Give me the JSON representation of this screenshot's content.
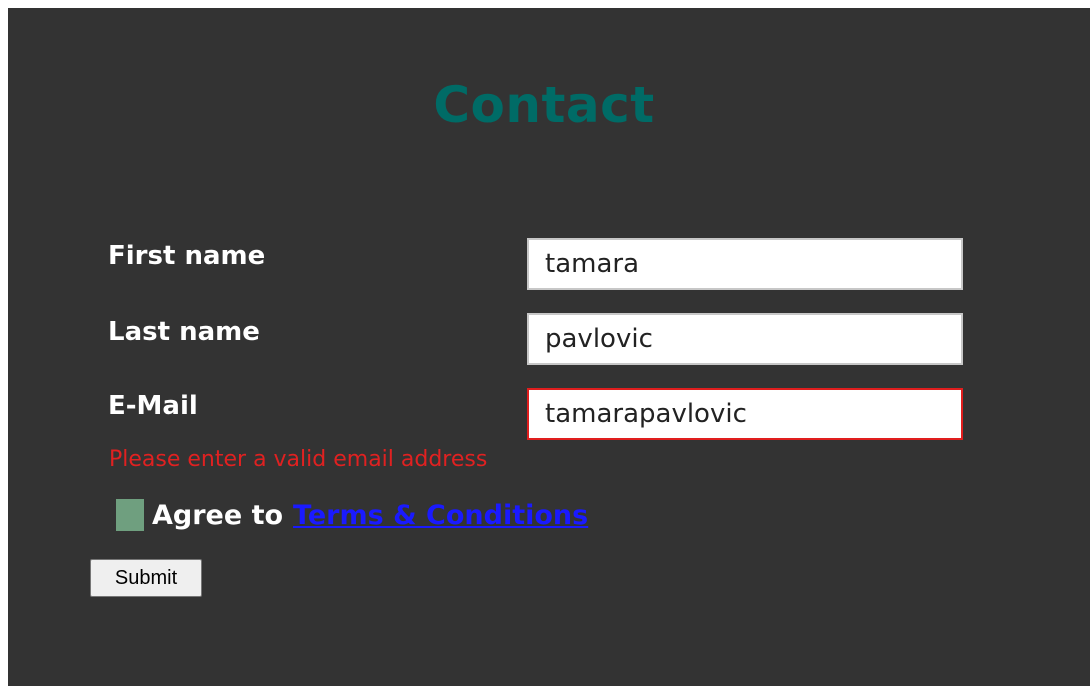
{
  "page": {
    "title": "Contact"
  },
  "form": {
    "first_name": {
      "label": "First name",
      "value": "tamara"
    },
    "last_name": {
      "label": "Last name",
      "value": "pavlovic"
    },
    "email": {
      "label": "E-Mail",
      "value": "tamarapavlovic",
      "error": "Please enter a valid email address"
    },
    "agree": {
      "text": "Agree to",
      "link_text": "Terms & Conditions"
    },
    "submit_label": "Submit"
  },
  "colors": {
    "background": "#333333",
    "title": "#006b66",
    "error": "#e02121",
    "link": "#1a1aff",
    "checkbox": "#6f9f7f"
  }
}
